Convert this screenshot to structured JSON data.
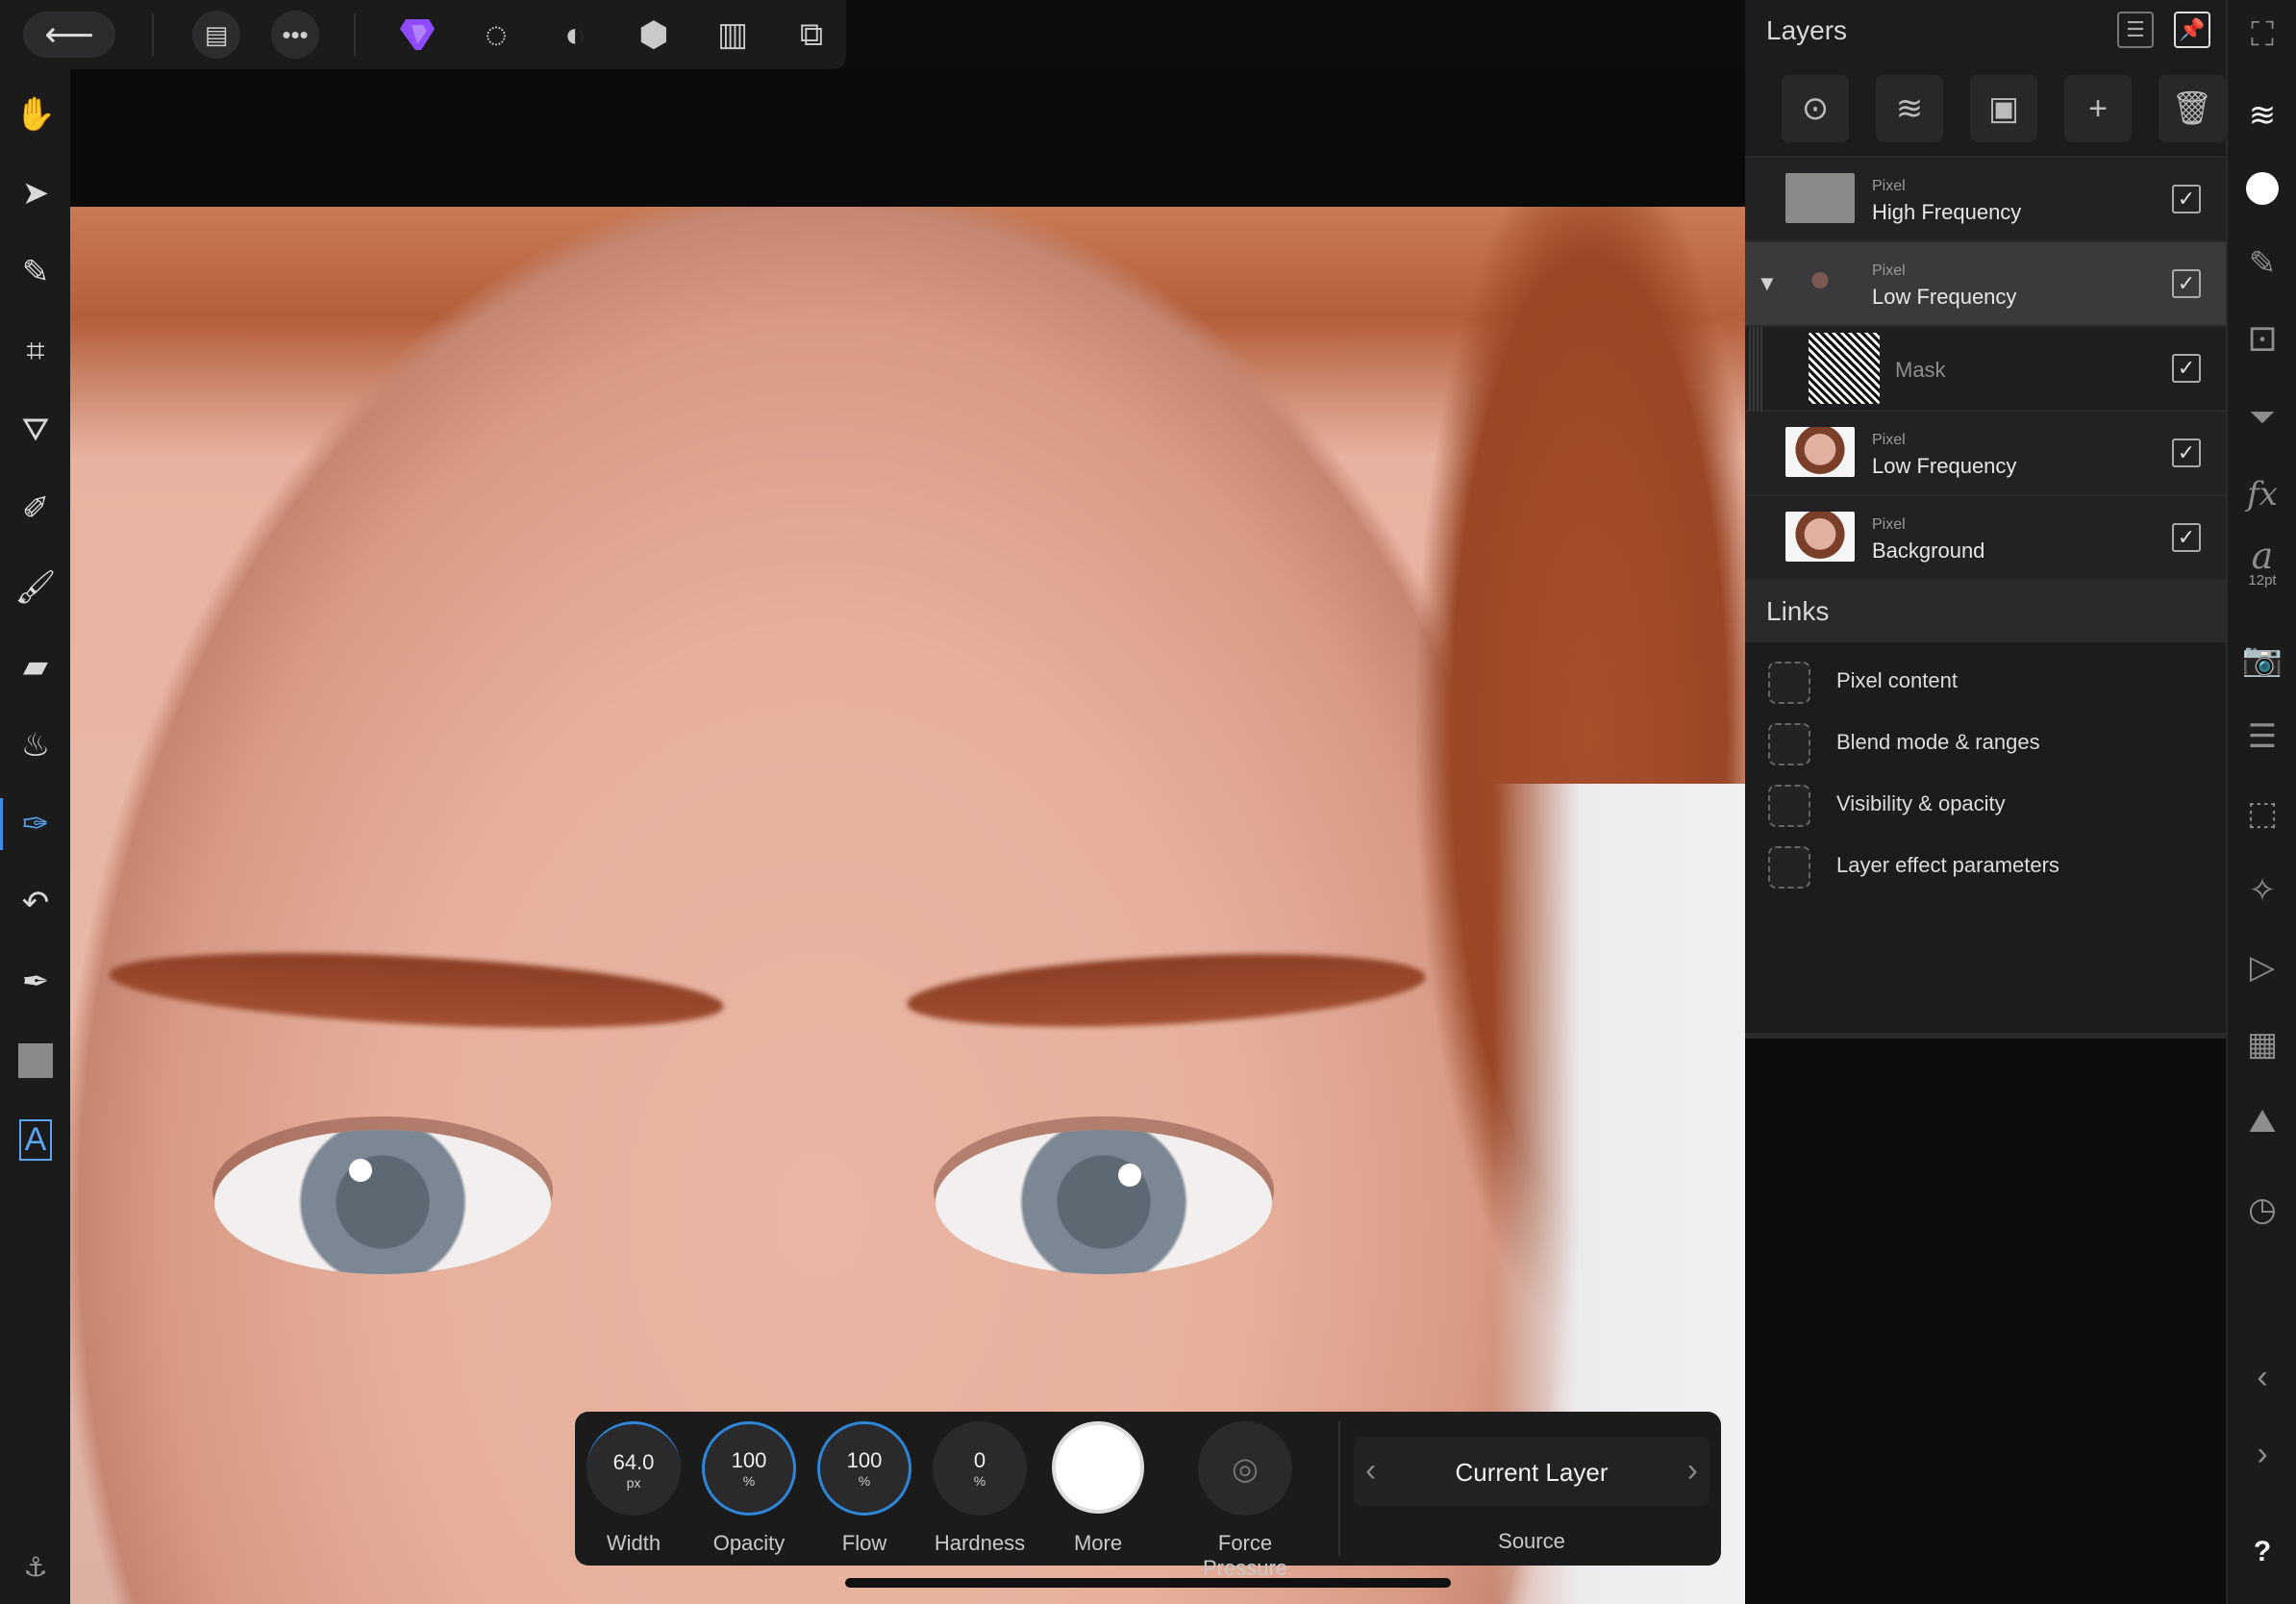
{
  "top_toolbar": {
    "back_icon": "arrow-left-icon",
    "document_icon": "document-icon",
    "more_icon": "ellipsis-icon",
    "personas": [
      "photo-persona-icon",
      "liquify-persona-icon",
      "develop-persona-icon",
      "tone-mapping-persona-icon",
      "export-persona-icon"
    ],
    "view_icon": "view-mode-icon"
  },
  "tools": [
    {
      "name": "hand-tool",
      "icon": "hand-icon"
    },
    {
      "name": "move-tool",
      "icon": "pointer-icon"
    },
    {
      "name": "color-picker-tool",
      "icon": "eyedropper-icon"
    },
    {
      "name": "crop-tool",
      "icon": "crop-icon"
    },
    {
      "name": "flood-fill-tool",
      "icon": "paint-bucket-icon"
    },
    {
      "name": "selection-brush-tool",
      "icon": "selection-brush-icon"
    },
    {
      "name": "paint-brush-tool",
      "icon": "brush-icon"
    },
    {
      "name": "erase-tool",
      "icon": "eraser-icon"
    },
    {
      "name": "burn-tool",
      "icon": "flame-icon"
    },
    {
      "name": "healing-brush-tool",
      "icon": "healing-brush-icon"
    },
    {
      "name": "undo-brush-tool",
      "icon": "undo-brush-icon"
    },
    {
      "name": "pen-tool",
      "icon": "pen-icon"
    },
    {
      "name": "rectangle-tool",
      "icon": "rectangle-icon"
    },
    {
      "name": "text-tool",
      "icon": "text-icon"
    }
  ],
  "layers_panel": {
    "title": "Layers",
    "layers": [
      {
        "type": "Pixel",
        "name": "High Frequency",
        "checked": true
      },
      {
        "type": "Pixel",
        "name": "Low Frequency",
        "checked": true,
        "selected": true,
        "expanded": true
      },
      {
        "type": "",
        "name": "Mask",
        "checked": true,
        "child": true
      },
      {
        "type": "Pixel",
        "name": "Low Frequency",
        "checked": true
      },
      {
        "type": "Pixel",
        "name": "Background",
        "checked": true
      }
    ],
    "check_glyph": "✓"
  },
  "links": {
    "title": "Links",
    "items": [
      "Pixel content",
      "Blend mode & ranges",
      "Visibility & opacity",
      "Layer effect parameters"
    ]
  },
  "right_strip": {
    "text_size": "12pt"
  },
  "context_toolbar": {
    "width": {
      "value": "64.0",
      "unit": "px",
      "label": "Width"
    },
    "opacity": {
      "value": "100",
      "unit": "%",
      "label": "Opacity"
    },
    "flow": {
      "value": "100",
      "unit": "%",
      "label": "Flow"
    },
    "hardness": {
      "value": "0",
      "unit": "%",
      "label": "Hardness"
    },
    "more_label": "More",
    "force_pressure_label": "Force Pressure",
    "source": {
      "value": "Current Layer",
      "label": "Source"
    }
  },
  "colors": {
    "accent": "#2d86d8",
    "persona_active": "#8e4bff",
    "panel_bg": "#1c1c1e"
  }
}
